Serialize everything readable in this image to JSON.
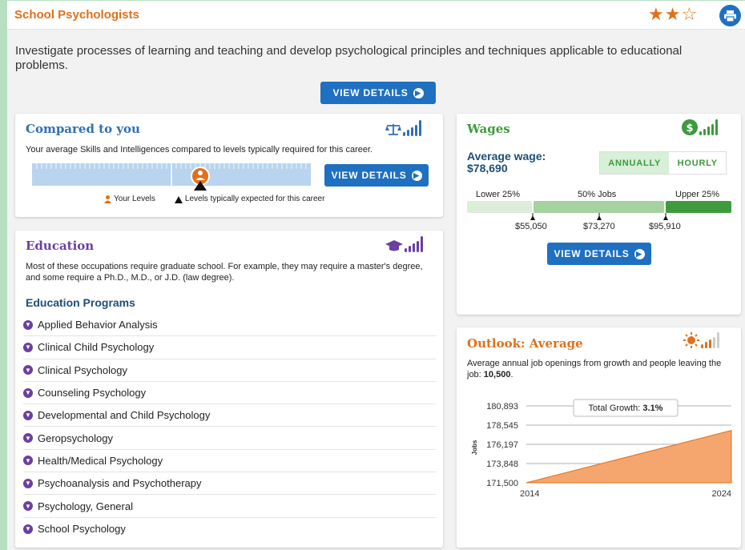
{
  "header": {
    "title": "School Psychologists",
    "stars": "★★☆",
    "print_icon": "printer-icon"
  },
  "description": "Investigate processes of learning and teaching and develop psychological principles and techniques applicable to educational problems.",
  "top_button": "VIEW DETAILS",
  "compared": {
    "title": "Compared to you",
    "text": "Your average Skills and Intelligences compared to levels typically required for this career.",
    "button": "VIEW DETAILS",
    "legend_your": "Your Levels",
    "legend_expected": "Levels typically expected for this career",
    "colors": {
      "title": "#2f6fb3",
      "bar": "#b8d4ef",
      "marker": "#e0701a"
    }
  },
  "education": {
    "title": "Education",
    "text": "Most of these occupations require graduate school. For example, they may require a master's degree, and some require a Ph.D., M.D., or J.D. (law degree).",
    "programs_title": "Education Programs",
    "programs": [
      "Applied Behavior Analysis",
      "Clinical Child Psychology",
      "Clinical Psychology",
      "Counseling Psychology",
      "Developmental and Child Psychology",
      "Geropsychology",
      "Health/Medical Psychology",
      "Psychoanalysis and Psychotherapy",
      "Psychology, General",
      "School Psychology"
    ],
    "colors": {
      "title": "#6b3fa0",
      "programs_title": "#1d4e7a"
    }
  },
  "wages": {
    "title": "Wages",
    "avg_label": "Average wage:",
    "avg_value": "$78,690",
    "toggle_annual": "ANNUALLY",
    "toggle_hourly": "HOURLY",
    "lower": "Lower 25%",
    "middle": "50% Jobs",
    "upper": "Upper 25%",
    "p25": "$55,050",
    "median": "$73,270",
    "p75": "$95,910",
    "button": "VIEW DETAILS",
    "colors": {
      "title": "#3d9a3d"
    }
  },
  "outlook": {
    "title": "Outlook: Average",
    "text_prefix": "Average annual job openings from growth and people leaving the job: ",
    "openings": "10,500",
    "openings_suffix": ".",
    "growth_label": "Total Growth: ",
    "growth_value": "3.1%",
    "ylabel": "Jobs",
    "yticks": [
      "180,893",
      "178,545",
      "176,197",
      "173,848",
      "171,500"
    ],
    "colors": {
      "title": "#e0701a",
      "area": "#f5a66e"
    }
  },
  "chart_data": {
    "type": "area",
    "x": [
      2014,
      2024
    ],
    "values": [
      171500,
      177900
    ],
    "ylabel": "Jobs",
    "ylim": [
      171500,
      180893
    ],
    "yticks": [
      180893,
      178545,
      176197,
      173848,
      171500
    ],
    "xticks": [
      "2014",
      "2024"
    ],
    "grid": true,
    "annotation": "Total Growth: 3.1%"
  }
}
